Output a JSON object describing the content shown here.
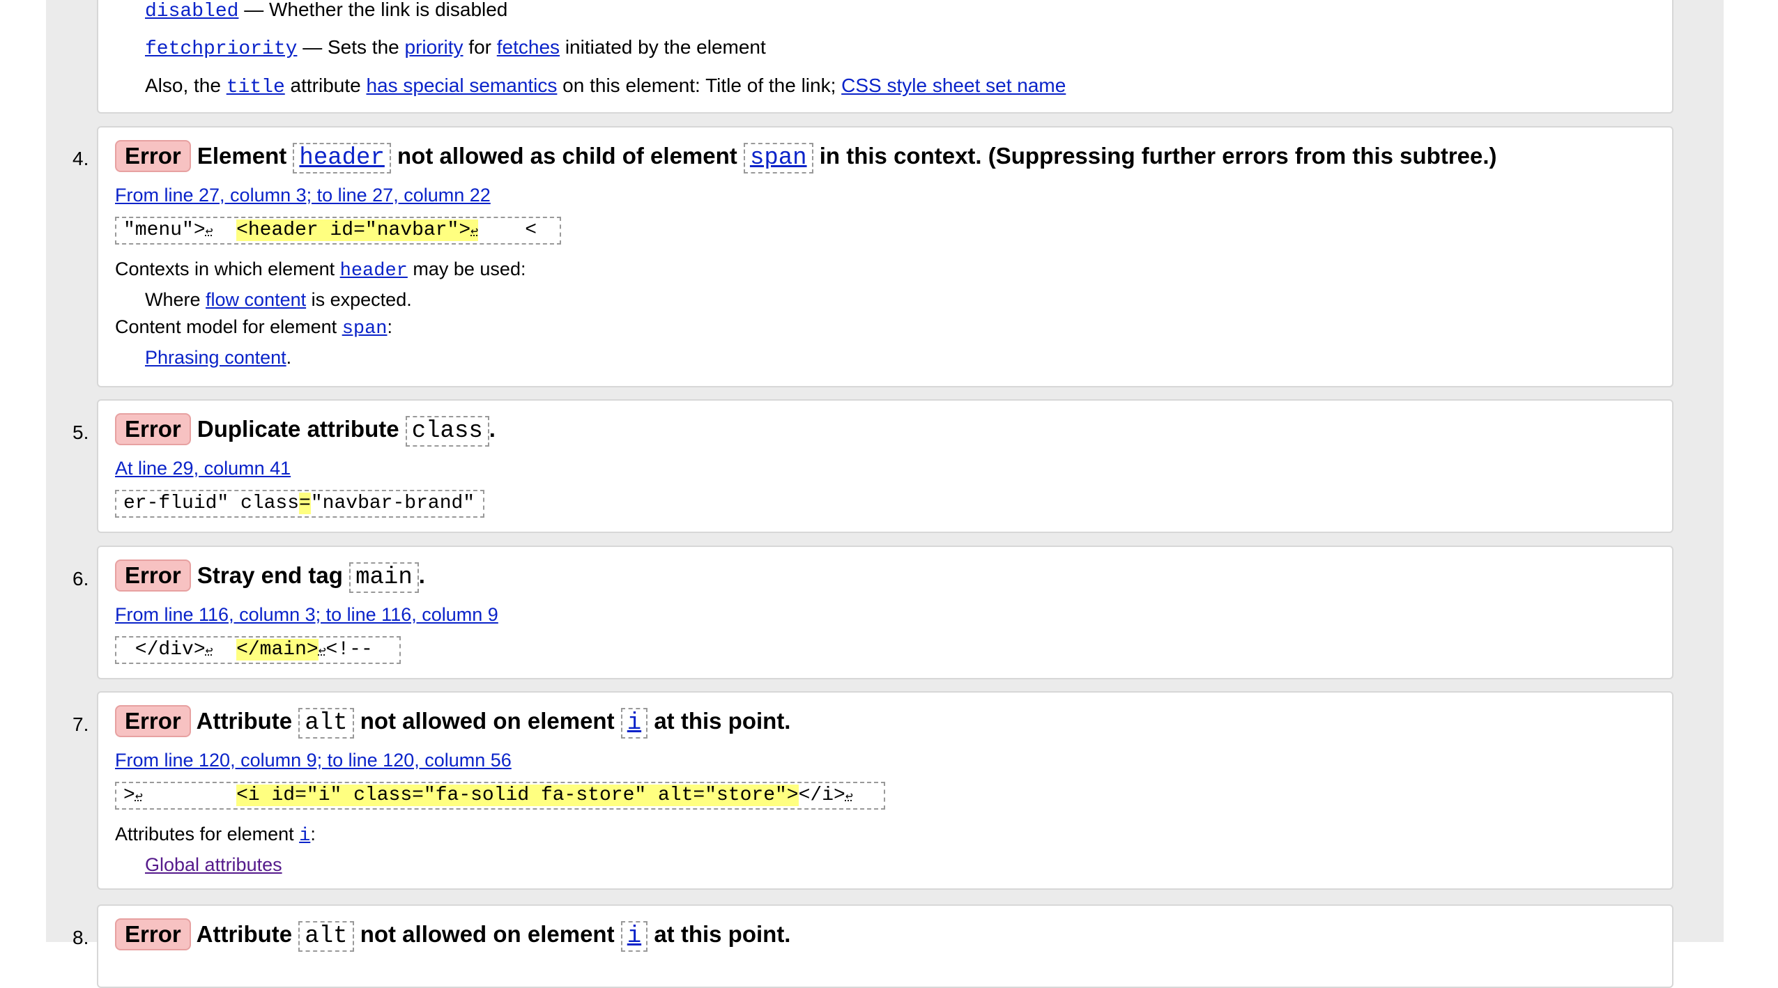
{
  "partial_top": {
    "disabled_code": "disabled",
    "disabled_desc": " — Whether the link is disabled",
    "fetchpriority_code": "fetchpriority",
    "fetchpriority_sep": " — Sets the ",
    "priority_link": "priority",
    "for_text": " for ",
    "fetches_link": "fetches",
    "initiated_text": " initiated by the element",
    "also_text": "Also, the ",
    "title_code": "title",
    "attribute_text": " attribute ",
    "special_link": "has special semantics",
    "on_element_text": " on this element: Title of the link; ",
    "css_link": "CSS style sheet set name"
  },
  "messages": [
    {
      "num": "4.",
      "badge": "Error",
      "t1": "Element ",
      "c1": "header",
      "t2": " not allowed as child of element ",
      "c2": "span",
      "t3": " in this context. (Suppressing further errors from this subtree.)",
      "location": "From line 27, column 3; to line 27, column 22",
      "ex_pre": "\"menu\">",
      "ex_lf1": "↩",
      "ex_hl": "<header id=\"navbar\">",
      "ex_lf2": "↩",
      "ex_post": "    <",
      "ctx_text": "Contexts in which element ",
      "ctx_code": "header",
      "ctx_end": " may be used:",
      "where_text": "Where ",
      "flow_link": "flow content",
      "expected": " is expected.",
      "model_text": "Content model for element ",
      "model_code": "span",
      "model_end": ":",
      "phrasing_link": "Phrasing content",
      "phrasing_end": "."
    },
    {
      "num": "5.",
      "badge": "Error",
      "t1": "Duplicate attribute ",
      "c1": "class",
      "t2": ".",
      "location": "At line 29, column 41",
      "ex_pre": "er-fluid\" class",
      "ex_hl": "=",
      "ex_post": "\"navbar-brand\""
    },
    {
      "num": "6.",
      "badge": "Error",
      "t1": "Stray end tag ",
      "c1": "main",
      "t2": ".",
      "location": "From line 116, column 3; to line 116, column 9",
      "ex_pre": " </div>",
      "ex_lf1": "↩",
      "ex_hl": "</main>",
      "ex_lf2": "↩",
      "ex_post": "<!--"
    },
    {
      "num": "7.",
      "badge": "Error",
      "t1": "Attribute ",
      "c1": "alt",
      "t2": " not allowed on element ",
      "c2": "i",
      "t3": " at this point.",
      "location": "From line 120, column 9; to line 120, column 56",
      "ex_pre": ">",
      "ex_lf1": "↩",
      "ex_hl": "<i id=\"i\" class=\"fa-solid fa-store\" alt=\"store\">",
      "ex_post": "</i>",
      "ex_lf2": "↩",
      "attrs_text": "Attributes for element ",
      "attrs_code": "i",
      "attrs_end": ":",
      "global_link": "Global attributes"
    },
    {
      "num": "8.",
      "badge": "Error",
      "t1": "Attribute ",
      "c1": "alt",
      "t2": " not allowed on element ",
      "c2": "i",
      "t3": " at this point."
    }
  ],
  "colors": {
    "badge_bg": "#f7c2c2",
    "link": "#0a23c9",
    "highlight": "#ffff80",
    "page_bg": "#ebebeb"
  }
}
